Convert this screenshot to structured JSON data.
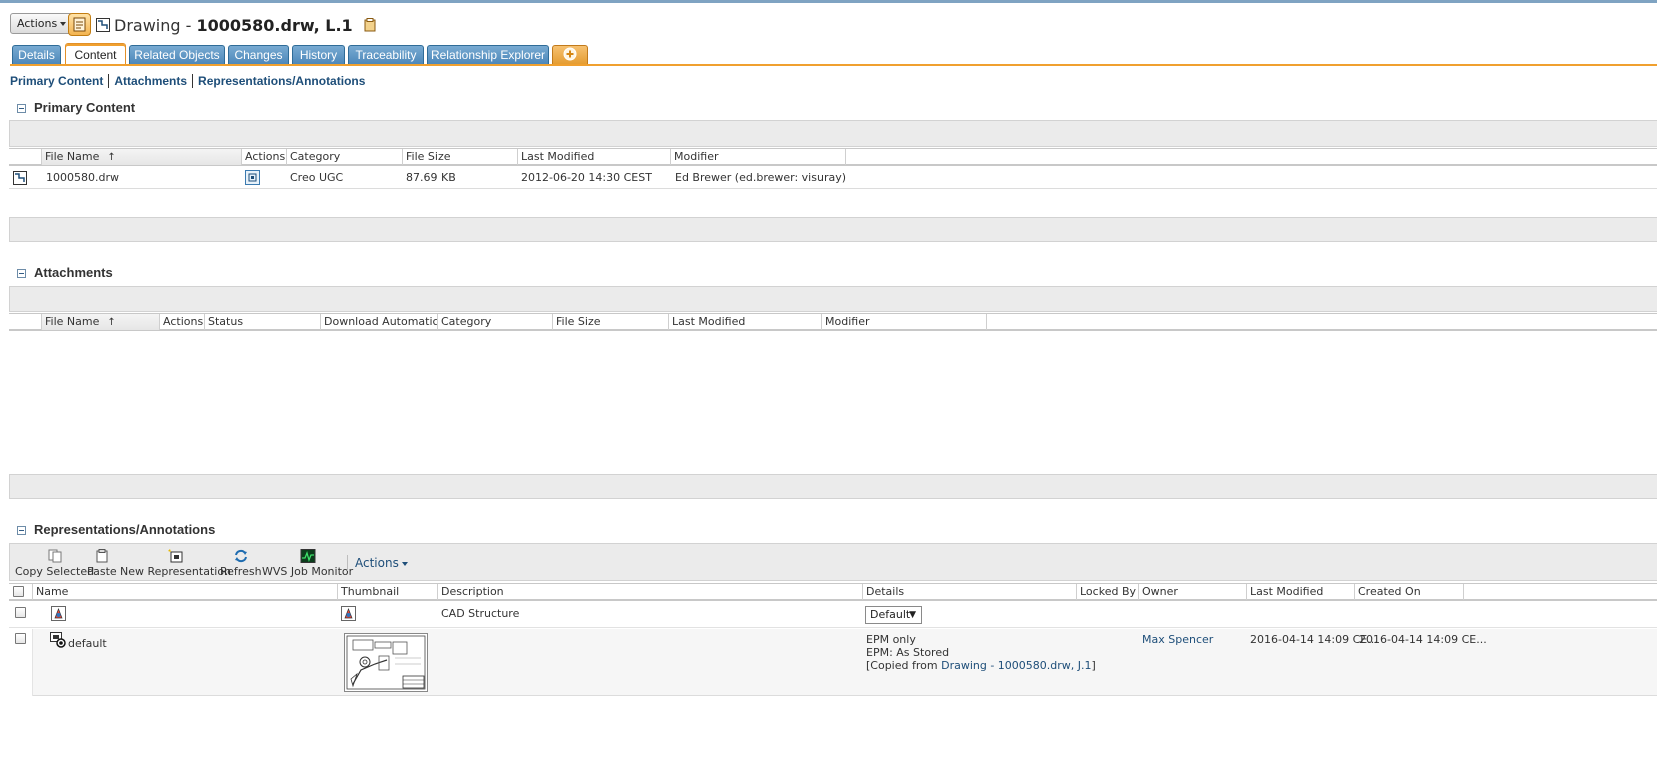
{
  "header": {
    "actions_label": "Actions",
    "title_prefix": "Drawing - ",
    "title_name": "1000580.drw, L.1"
  },
  "tabs": [
    {
      "label": "Details",
      "active": false
    },
    {
      "label": "Content",
      "active": true
    },
    {
      "label": "Related Objects",
      "active": false
    },
    {
      "label": "Changes",
      "active": false
    },
    {
      "label": "History",
      "active": false
    },
    {
      "label": "Traceability",
      "active": false
    },
    {
      "label": "Relationship Explorer",
      "active": false
    },
    {
      "label": "+",
      "active": false
    }
  ],
  "subnav": [
    "Primary Content",
    "Attachments",
    "Representations/Annotations"
  ],
  "primary_content": {
    "title": "Primary Content",
    "columns": [
      "File Name",
      "Actions",
      "Category",
      "File Size",
      "Last Modified",
      "Modifier"
    ],
    "sort_indicator": "↑",
    "rows": [
      {
        "file_name": "1000580.drw",
        "category": "Creo UGC",
        "file_size": "87.69 KB",
        "last_modified": "2012-06-20 14:30 CEST",
        "modifier": "Ed Brewer (ed.brewer: visuray)"
      }
    ]
  },
  "attachments": {
    "title": "Attachments",
    "columns": [
      "File Name",
      "Actions",
      "Status",
      "Download Automatically",
      "Category",
      "File Size",
      "Last Modified",
      "Modifier"
    ],
    "sort_indicator": "↑"
  },
  "representations": {
    "title": "Representations/Annotations",
    "toolbar": {
      "copy_selected": "Copy Selected",
      "paste": "Paste",
      "new_representation": "New Representation",
      "refresh": "Refresh",
      "wvs_job_monitor": "WVS Job Monitor",
      "actions": "Actions"
    },
    "columns": [
      "Name",
      "Thumbnail",
      "Description",
      "Details",
      "Locked By",
      "Owner",
      "Last Modified",
      "Created On"
    ],
    "rows": [
      {
        "name": "",
        "description": "CAD Structure",
        "details_select": "Default"
      },
      {
        "name": "default",
        "details_line1": "EPM only",
        "details_line2": "EPM: As Stored",
        "details_line3_prefix": "[Copied from ",
        "details_line3_link": "Drawing - 1000580.drw, J.1",
        "details_line3_suffix": "]",
        "owner": "Max Spencer",
        "last_modified": "2016-04-14 14:09 CE...",
        "created_on": "2016-04-14 14:09 CE..."
      }
    ]
  },
  "colors": {
    "tab_blue": "#4b86b8",
    "tab_orange": "#f0a02f",
    "link_blue": "#1e4e79"
  }
}
